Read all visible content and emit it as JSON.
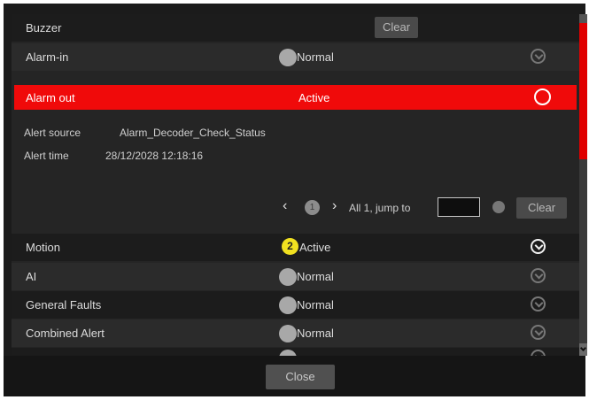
{
  "buzzer": {
    "label": "Buzzer",
    "clear_label": "Clear"
  },
  "alarm_rows": [
    {
      "name": "Alarm-in",
      "status": "Normal"
    },
    {
      "name": "Alarm out",
      "status": "Active"
    }
  ],
  "details": {
    "source_label": "Alert source",
    "source_value": "Alarm_Decoder_Check_Status",
    "time_label": "Alert time",
    "time_value": "28/12/2028 12:18:16"
  },
  "pager": {
    "prev_icon": "chevron-left-icon",
    "current_page": "1",
    "next_icon": "chevron-right-icon",
    "summary": "All 1, jump to",
    "jump_value": "",
    "clear_label": "Clear"
  },
  "event_rows": [
    {
      "name": "Motion",
      "status": "Active",
      "badge": "2"
    },
    {
      "name": "AI",
      "status": "Normal"
    },
    {
      "name": "General Faults",
      "status": "Normal"
    },
    {
      "name": "Combined Alert",
      "status": "Normal"
    }
  ],
  "footer": {
    "close_label": "Close"
  },
  "colors": {
    "alarm_active": "#f00a0a",
    "scrollbar_thumb": "#e00000",
    "badge": "#f0e020"
  }
}
